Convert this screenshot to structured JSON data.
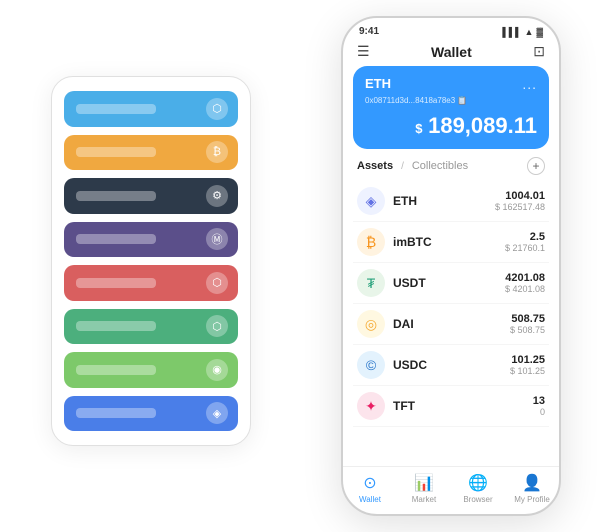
{
  "scene": {
    "backPanel": {
      "rows": [
        {
          "color": "row-blue",
          "label": "Blue card"
        },
        {
          "color": "row-orange",
          "label": "Orange card"
        },
        {
          "color": "row-dark",
          "label": "Dark card"
        },
        {
          "color": "row-purple",
          "label": "Purple card"
        },
        {
          "color": "row-red",
          "label": "Red card"
        },
        {
          "color": "row-green",
          "label": "Green card"
        },
        {
          "color": "row-lightgreen",
          "label": "Light green card"
        },
        {
          "color": "row-royalblue",
          "label": "Royal blue card"
        }
      ]
    },
    "phone": {
      "statusBar": {
        "time": "9:41",
        "signal": "▌▌▌",
        "wifi": "▲",
        "battery": "▓"
      },
      "header": {
        "menuIcon": "☰",
        "title": "Wallet",
        "expandIcon": "⊡"
      },
      "ethCard": {
        "label": "ETH",
        "address": "0x08711d3d...8418a78e3 📋",
        "moreIcon": "...",
        "balancePrefix": "$ ",
        "balance": "189,089.11"
      },
      "assetsTabs": {
        "active": "Assets",
        "separator": "/",
        "inactive": "Collectibles"
      },
      "addIcon": "+",
      "assets": [
        {
          "name": "ETH",
          "iconSymbol": "◈",
          "iconClass": "icon-eth",
          "amount": "1004.01",
          "usd": "$ 162517.48"
        },
        {
          "name": "imBTC",
          "iconSymbol": "₿",
          "iconClass": "icon-imbtc",
          "amount": "2.5",
          "usd": "$ 21760.1"
        },
        {
          "name": "USDT",
          "iconSymbol": "₮",
          "iconClass": "icon-usdt",
          "amount": "4201.08",
          "usd": "$ 4201.08"
        },
        {
          "name": "DAI",
          "iconSymbol": "◎",
          "iconClass": "icon-dai",
          "amount": "508.75",
          "usd": "$ 508.75"
        },
        {
          "name": "USDC",
          "iconSymbol": "©",
          "iconClass": "icon-usdc",
          "amount": "101.25",
          "usd": "$ 101.25"
        },
        {
          "name": "TFT",
          "iconSymbol": "✦",
          "iconClass": "icon-tft",
          "amount": "13",
          "usd": "0"
        }
      ],
      "bottomNav": [
        {
          "id": "wallet",
          "icon": "⊙",
          "label": "Wallet",
          "active": true
        },
        {
          "id": "market",
          "icon": "📊",
          "label": "Market",
          "active": false
        },
        {
          "id": "browser",
          "icon": "🌐",
          "label": "Browser",
          "active": false
        },
        {
          "id": "profile",
          "icon": "👤",
          "label": "My Profile",
          "active": false
        }
      ]
    }
  }
}
